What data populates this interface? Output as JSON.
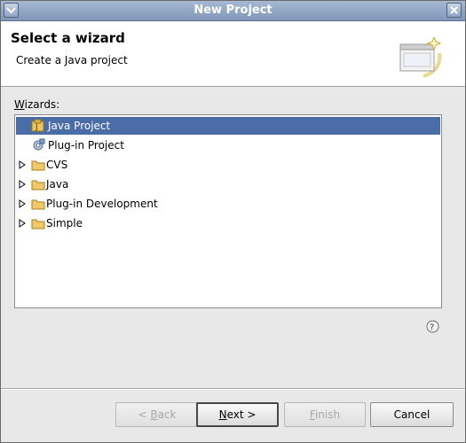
{
  "window": {
    "title": "New Project"
  },
  "header": {
    "title": "Select a wizard",
    "description": "Create a Java project"
  },
  "wizards": {
    "label_accel": "W",
    "label_rest": "izards:",
    "items": [
      {
        "label": "Java Project",
        "icon": "java-project-icon",
        "expandable": false,
        "selected": true
      },
      {
        "label": "Plug-in Project",
        "icon": "plugin-project-icon",
        "expandable": false,
        "selected": false
      },
      {
        "label": "CVS",
        "icon": "folder-icon",
        "expandable": true,
        "selected": false
      },
      {
        "label": "Java",
        "icon": "folder-icon",
        "expandable": true,
        "selected": false
      },
      {
        "label": "Plug-in Development",
        "icon": "folder-icon",
        "expandable": true,
        "selected": false
      },
      {
        "label": "Simple",
        "icon": "folder-icon",
        "expandable": true,
        "selected": false
      }
    ]
  },
  "buttons": {
    "back": {
      "prefix": "< ",
      "accel": "B",
      "rest": "ack"
    },
    "next": {
      "accel": "N",
      "rest": "ext >"
    },
    "finish": {
      "accel": "F",
      "rest": "inish"
    },
    "cancel": {
      "label": "Cancel"
    }
  },
  "colors": {
    "selection": "#4a6da7",
    "titlebar": "#8ea3c2"
  }
}
